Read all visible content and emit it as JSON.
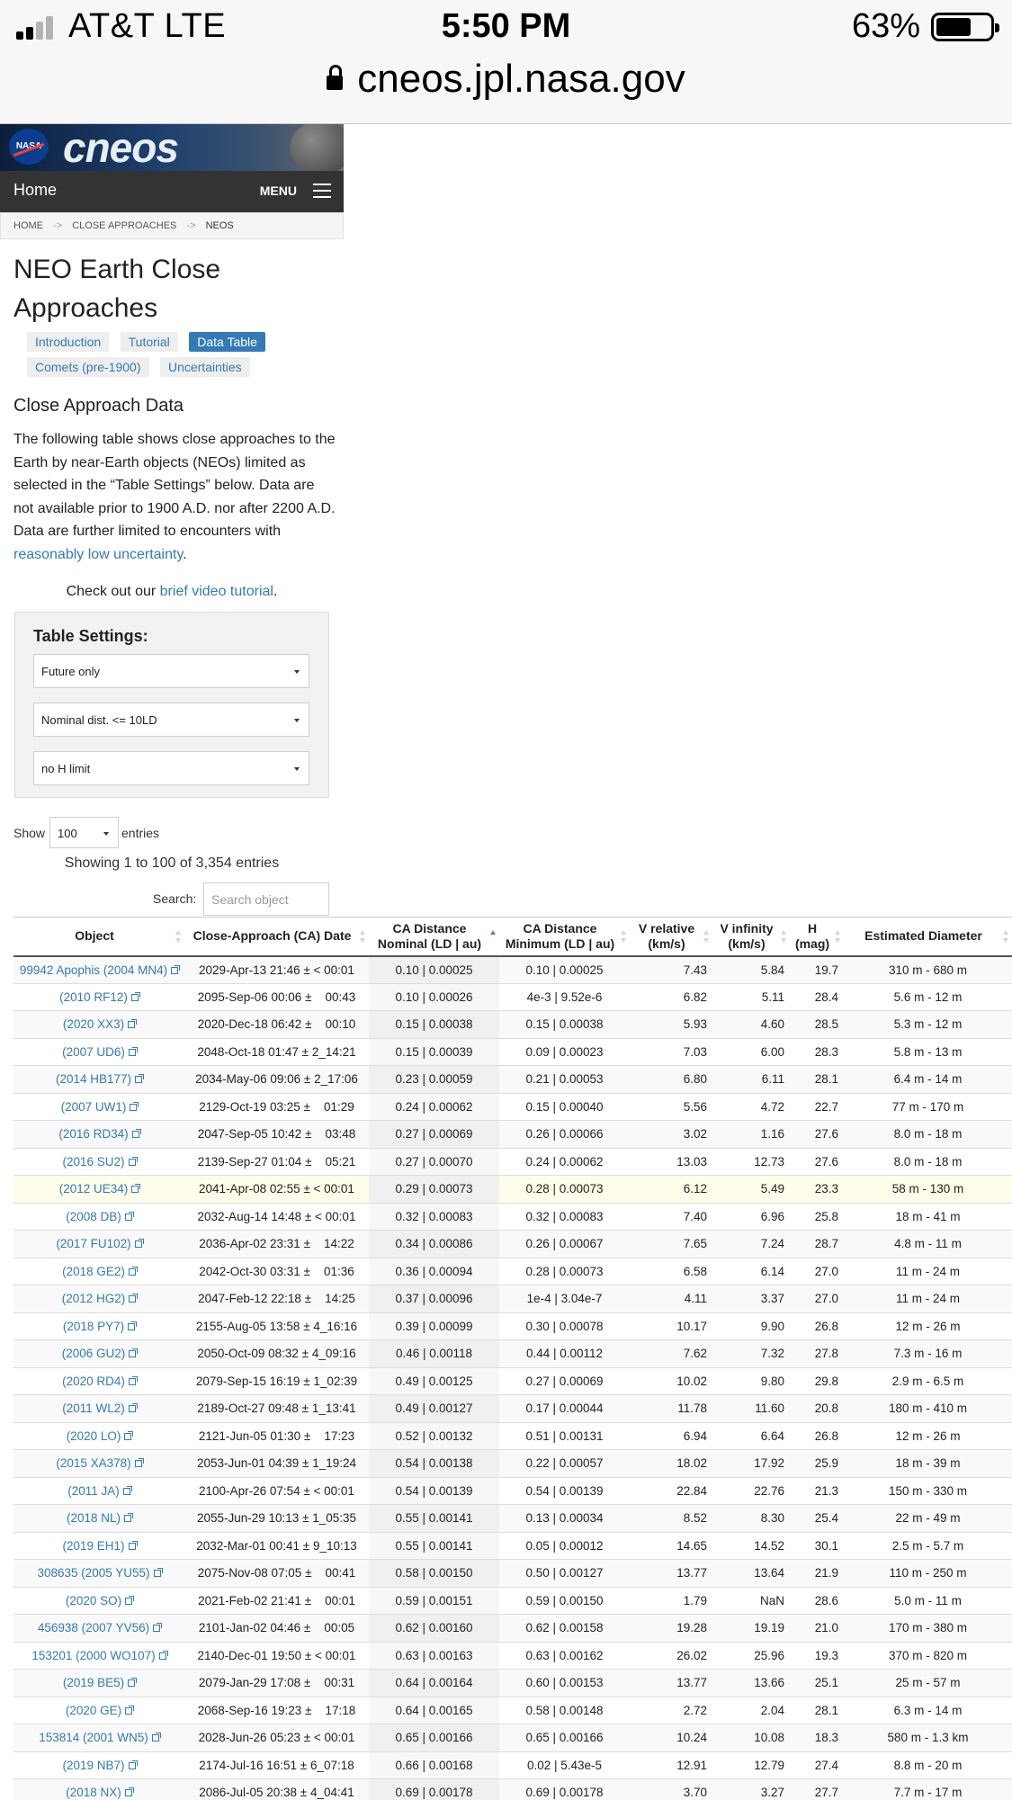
{
  "status": {
    "carrier": "AT&T  LTE",
    "time": "5:50 PM",
    "battery": "63%",
    "battery_level": 0.63,
    "signal_bars": 2
  },
  "browser": {
    "url": "cneos.jpl.nasa.gov"
  },
  "header": {
    "nasa_logo": "NASA",
    "site_logo": "cneos",
    "nav_home": "Home",
    "nav_menu": "MENU"
  },
  "breadcrumb": [
    "HOME",
    "CLOSE APPROACHES",
    "NEOS"
  ],
  "breadcrumb_sep": "->",
  "page": {
    "title": "NEO Earth Close Approaches",
    "tabs": [
      {
        "label": "Introduction",
        "active": false
      },
      {
        "label": "Tutorial",
        "active": false
      },
      {
        "label": "Data Table",
        "active": true
      },
      {
        "label": "Comets (pre-1900)",
        "active": false
      },
      {
        "label": "Uncertainties",
        "active": false
      }
    ],
    "section_title": "Close Approach Data",
    "intro_text": "The following table shows close approaches to the Earth by near-Earth objects (NEOs) limited as selected in the “Table Settings” below. Data are not available prior to 1900 A.D. nor after 2200 A.D. Data are further limited to encounters with ",
    "intro_link": "reasonably low uncertainty",
    "intro_end": ".",
    "video_prefix": "Check out our ",
    "video_link": "brief video tutorial",
    "video_end": "."
  },
  "settings": {
    "title": "Table Settings:",
    "time_filter": "Future only",
    "distance_filter": "Nominal dist. <= 10LD",
    "h_filter": "no H limit"
  },
  "controls": {
    "show_label": "Show",
    "show_value": "100",
    "entries_label": "entries",
    "showing_text": "Showing 1 to 100 of 3,354 entries",
    "search_label": "Search:",
    "search_placeholder": "Search object"
  },
  "table": {
    "headers": [
      "Object",
      "Close-Approach (CA) Date",
      "CA Distance\nNominal (LD | au)",
      "CA Distance\nMinimum (LD | au)",
      "V relative\n(km/s)",
      "V infinity\n(km/s)",
      "H\n(mag)",
      "Estimated Diameter"
    ],
    "rows": [
      [
        "99942 Apophis (2004 MN4)",
        "2029-Apr-13 21:46 ± < 00:01",
        "0.10 | 0.00025",
        "0.10 | 0.00025",
        "7.43",
        "5.84",
        "19.7",
        "310 m - 680 m"
      ],
      [
        "(2010 RF12)",
        "2095-Sep-06 00:06 ±    00:43",
        "0.10 | 0.00026",
        "4e-3 | 9.52e-6",
        "6.82",
        "5.11",
        "28.4",
        "5.6 m - 12 m"
      ],
      [
        "(2020 XX3)",
        "2020-Dec-18 06:42 ±    00:10",
        "0.15 | 0.00038",
        "0.15 | 0.00038",
        "5.93",
        "4.60",
        "28.5",
        "5.3 m - 12 m"
      ],
      [
        "(2007 UD6)",
        "2048-Oct-18 01:47 ± 2_14:21",
        "0.15 | 0.00039",
        "0.09 | 0.00023",
        "7.03",
        "6.00",
        "28.3",
        "5.8 m - 13 m"
      ],
      [
        "(2014 HB177)",
        "2034-May-06 09:06 ± 2_17:06",
        "0.23 | 0.00059",
        "0.21 | 0.00053",
        "6.80",
        "6.11",
        "28.1",
        "6.4 m - 14 m"
      ],
      [
        "(2007 UW1)",
        "2129-Oct-19 03:25 ±    01:29",
        "0.24 | 0.00062",
        "0.15 | 0.00040",
        "5.56",
        "4.72",
        "22.7",
        "77 m - 170 m"
      ],
      [
        "(2016 RD34)",
        "2047-Sep-05 10:42 ±    03:48",
        "0.27 | 0.00069",
        "0.26 | 0.00066",
        "3.02",
        "1.16",
        "27.6",
        "8.0 m - 18 m"
      ],
      [
        "(2016 SU2)",
        "2139-Sep-27 01:04 ±    05:21",
        "0.27 | 0.00070",
        "0.24 | 0.00062",
        "13.03",
        "12.73",
        "27.6",
        "8.0 m - 18 m"
      ],
      [
        "(2012 UE34)",
        "2041-Apr-08 02:55 ± < 00:01",
        "0.29 | 0.00073",
        "0.28 | 0.00073",
        "6.12",
        "5.49",
        "23.3",
        "58 m - 130 m"
      ],
      [
        "(2008 DB)",
        "2032-Aug-14 14:48 ± < 00:01",
        "0.32 | 0.00083",
        "0.32 | 0.00083",
        "7.40",
        "6.96",
        "25.8",
        "18 m - 41 m"
      ],
      [
        "(2017 FU102)",
        "2036-Apr-02 23:31 ±    14:22",
        "0.34 | 0.00086",
        "0.26 | 0.00067",
        "7.65",
        "7.24",
        "28.7",
        "4.8 m - 11 m"
      ],
      [
        "(2018 GE2)",
        "2042-Oct-30 03:31 ±    01:36",
        "0.36 | 0.00094",
        "0.28 | 0.00073",
        "6.58",
        "6.14",
        "27.0",
        "11 m - 24 m"
      ],
      [
        "(2012 HG2)",
        "2047-Feb-12 22:18 ±    14:25",
        "0.37 | 0.00096",
        "1e-4 | 3.04e-7",
        "4.11",
        "3.37",
        "27.0",
        "11 m - 24 m"
      ],
      [
        "(2018 PY7)",
        "2155-Aug-05 13:58 ± 4_16:16",
        "0.39 | 0.00099",
        "0.30 | 0.00078",
        "10.17",
        "9.90",
        "26.8",
        "12 m - 26 m"
      ],
      [
        "(2006 GU2)",
        "2050-Oct-09 08:32 ± 4_09:16",
        "0.46 | 0.00118",
        "0.44 | 0.00112",
        "7.62",
        "7.32",
        "27.8",
        "7.3 m - 16 m"
      ],
      [
        "(2020 RD4)",
        "2079-Sep-15 16:19 ± 1_02:39",
        "0.49 | 0.00125",
        "0.27 | 0.00069",
        "10.02",
        "9.80",
        "29.8",
        "2.9 m - 6.5 m"
      ],
      [
        "(2011 WL2)",
        "2189-Oct-27 09:48 ± 1_13:41",
        "0.49 | 0.00127",
        "0.17 | 0.00044",
        "11.78",
        "11.60",
        "20.8",
        "180 m - 410 m"
      ],
      [
        "(2020 LO)",
        "2121-Jun-05 01:30 ±    17:23",
        "0.52 | 0.00132",
        "0.51 | 0.00131",
        "6.94",
        "6.64",
        "26.8",
        "12 m - 26 m"
      ],
      [
        "(2015 XA378)",
        "2053-Jun-01 04:39 ± 1_19:24",
        "0.54 | 0.00138",
        "0.22 | 0.00057",
        "18.02",
        "17.92",
        "25.9",
        "18 m - 39 m"
      ],
      [
        "(2011 JA)",
        "2100-Apr-26 07:54 ± < 00:01",
        "0.54 | 0.00139",
        "0.54 | 0.00139",
        "22.84",
        "22.76",
        "21.3",
        "150 m - 330 m"
      ],
      [
        "(2018 NL)",
        "2055-Jun-29 10:13 ± 1_05:35",
        "0.55 | 0.00141",
        "0.13 | 0.00034",
        "8.52",
        "8.30",
        "25.4",
        "22 m - 49 m"
      ],
      [
        "(2019 EH1)",
        "2032-Mar-01 00:41 ± 9_10:13",
        "0.55 | 0.00141",
        "0.05 | 0.00012",
        "14.65",
        "14.52",
        "30.1",
        "2.5 m - 5.7 m"
      ],
      [
        "308635 (2005 YU55)",
        "2075-Nov-08 07:05 ±    00:41",
        "0.58 | 0.00150",
        "0.50 | 0.00127",
        "13.77",
        "13.64",
        "21.9",
        "110 m - 250 m"
      ],
      [
        "(2020 SO)",
        "2021-Feb-02 21:41 ±    00:01",
        "0.59 | 0.00151",
        "0.59 | 0.00150",
        "1.79",
        "NaN",
        "28.6",
        "5.0 m - 11 m"
      ],
      [
        "456938 (2007 YV56)",
        "2101-Jan-02 04:46 ±    00:05",
        "0.62 | 0.00160",
        "0.62 | 0.00158",
        "19.28",
        "19.19",
        "21.0",
        "170 m - 380 m"
      ],
      [
        "153201 (2000 WO107)",
        "2140-Dec-01 19:50 ± < 00:01",
        "0.63 | 0.00163",
        "0.63 | 0.00162",
        "26.02",
        "25.96",
        "19.3",
        "370 m - 820 m"
      ],
      [
        "(2019 BE5)",
        "2079-Jan-29 17:08 ±    00:31",
        "0.64 | 0.00164",
        "0.60 | 0.00153",
        "13.77",
        "13.66",
        "25.1",
        "25 m - 57 m"
      ],
      [
        "(2020 GE)",
        "2068-Sep-16 19:23 ±    17:18",
        "0.64 | 0.00165",
        "0.58 | 0.00148",
        "2.72",
        "2.04",
        "28.1",
        "6.3 m - 14 m"
      ],
      [
        "153814 (2001 WN5)",
        "2028-Jun-26 05:23 ± < 00:01",
        "0.65 | 0.00166",
        "0.65 | 0.00166",
        "10.24",
        "10.08",
        "18.3",
        "580 m - 1.3 km"
      ],
      [
        "(2019 NB7)",
        "2174-Jul-16 16:51 ± 6_07:18",
        "0.66 | 0.00168",
        "0.02 | 5.43e-5",
        "12.91",
        "12.79",
        "27.4",
        "8.8 m - 20 m"
      ],
      [
        "(2018 NX)",
        "2086-Jul-05 20:38 ± 4_04:41",
        "0.69 | 0.00178",
        "0.69 | 0.00178",
        "3.70",
        "3.27",
        "27.7",
        "7.7 m - 17 m"
      ]
    ],
    "highlighted_row": 8
  }
}
